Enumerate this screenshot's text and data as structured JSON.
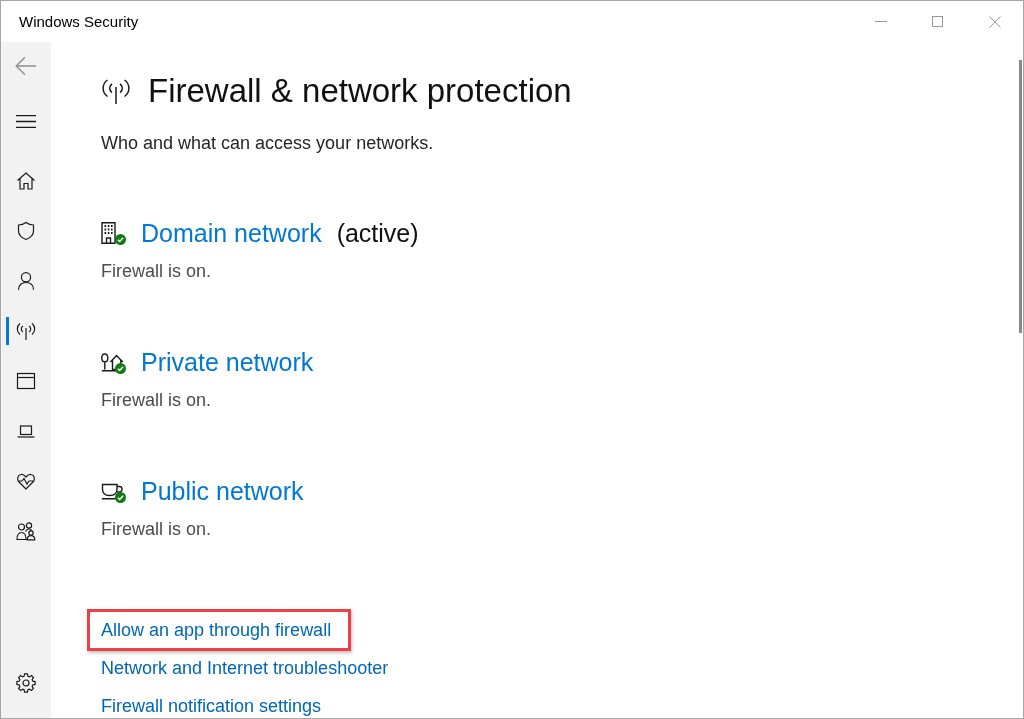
{
  "window": {
    "title": "Windows Security"
  },
  "sidebar": {
    "back": {
      "disabled": true
    },
    "items": [
      {
        "kind": "home",
        "selected": false
      },
      {
        "kind": "shield",
        "selected": false
      },
      {
        "kind": "person",
        "selected": false
      },
      {
        "kind": "antenna",
        "selected": true
      },
      {
        "kind": "window",
        "selected": false
      },
      {
        "kind": "laptop",
        "selected": false
      },
      {
        "kind": "heart",
        "selected": false
      },
      {
        "kind": "people",
        "selected": false
      }
    ],
    "footer_items": [
      {
        "kind": "settings",
        "selected": false
      }
    ]
  },
  "page": {
    "title": "Firewall & network protection",
    "subtitle": "Who and what can access your networks.",
    "networks": [
      {
        "kind": "domain",
        "name": "Domain network",
        "badge": "(active)",
        "status": "Firewall is on.",
        "protected": true
      },
      {
        "kind": "private",
        "name": "Private network",
        "status": "Firewall is on.",
        "protected": true
      },
      {
        "kind": "public",
        "name": "Public network",
        "status": "Firewall is on.",
        "protected": true
      }
    ],
    "links": [
      {
        "label": "Allow an app through firewall",
        "highlighted": true
      },
      {
        "label": "Network and Internet troubleshooter",
        "highlighted": false
      },
      {
        "label": "Firewall notification settings",
        "highlighted": false
      }
    ]
  }
}
